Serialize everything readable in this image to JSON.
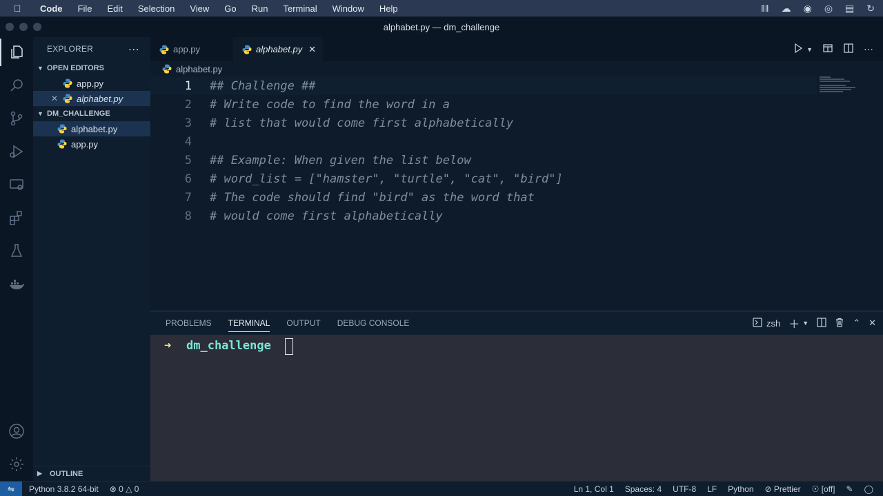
{
  "menubar": {
    "items": [
      "Code",
      "File",
      "Edit",
      "Selection",
      "View",
      "Go",
      "Run",
      "Terminal",
      "Window",
      "Help"
    ]
  },
  "window": {
    "title": "alphabet.py — dm_challenge"
  },
  "sidebar": {
    "header": "EXPLORER",
    "open_editors": {
      "title": "OPEN EDITORS",
      "items": [
        {
          "label": "app.py"
        },
        {
          "label": "alphabet.py"
        }
      ]
    },
    "project": {
      "title": "DM_CHALLENGE",
      "items": [
        {
          "label": "alphabet.py"
        },
        {
          "label": "app.py"
        }
      ]
    },
    "outline": "OUTLINE"
  },
  "tabs": [
    {
      "label": "app.py"
    },
    {
      "label": "alphabet.py"
    }
  ],
  "breadcrumb": "alphabet.py",
  "code": {
    "lines": [
      {
        "n": "1",
        "text": "## Challenge ##"
      },
      {
        "n": "2",
        "text": "# Write code to find the word in a"
      },
      {
        "n": "3",
        "text": "# list that would come first alphabetically"
      },
      {
        "n": "4",
        "text": ""
      },
      {
        "n": "5",
        "text": "## Example: When given the list below"
      },
      {
        "n": "6",
        "text": "# word_list = [\"hamster\", \"turtle\", \"cat\", \"bird\"]"
      },
      {
        "n": "7",
        "text": "# The code should find \"bird\" as the word that"
      },
      {
        "n": "8",
        "text": "# would come first alphabetically"
      }
    ]
  },
  "panel": {
    "tabs": [
      "PROBLEMS",
      "TERMINAL",
      "OUTPUT",
      "DEBUG CONSOLE"
    ],
    "shell": "zsh",
    "terminal": {
      "prompt_arrow": "➜",
      "cwd": "dm_challenge"
    }
  },
  "statusbar": {
    "python": "Python 3.8.2 64-bit",
    "errors": "0",
    "warnings": "0",
    "position": "Ln 1, Col 1",
    "spaces": "Spaces: 4",
    "encoding": "UTF-8",
    "eol": "LF",
    "language": "Python",
    "prettier": "Prettier",
    "off": "[off]"
  },
  "colors": {
    "background": "#0d1b2a",
    "comment": "#7f8d9c",
    "terminal_dir": "#7ee6d7",
    "terminal_arrow": "#f2e27a",
    "remote": "#1c5ea1"
  }
}
